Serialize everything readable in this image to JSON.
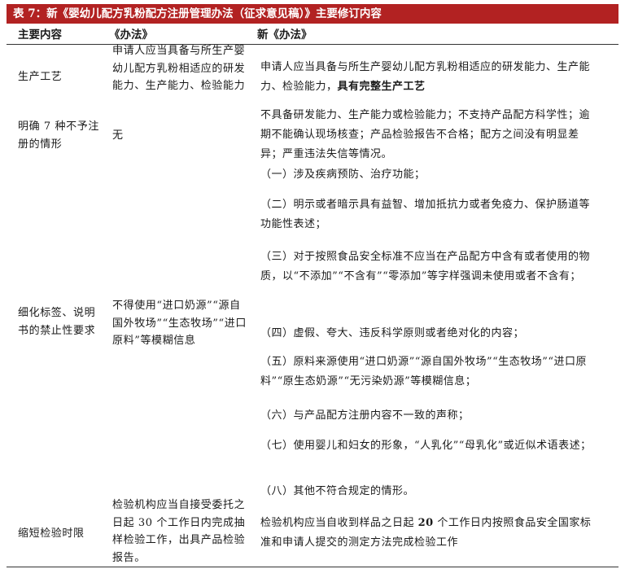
{
  "table": {
    "title": "表 7：新《婴幼儿配方乳粉配方注册管理办法（征求意见稿）》主要修订内容",
    "headers": [
      "主要内容",
      "《办法》",
      "新《办法》"
    ],
    "rows": [
      {
        "topic": "生产工艺",
        "old": "申请人应当具备与所生产婴幼儿配方乳粉相适应的研发能力、生产能力、检验能力",
        "new_plain": "申请人应当具备与所生产婴幼儿配方乳粉相适应的研发能力、生产能力、检验能力，",
        "new_bold": "具有完整生产工艺"
      },
      {
        "topic": "明确 7 种不予注册的情形",
        "old": "无",
        "new": "不具备研发能力、生产能力或检验能力；不支持产品配方科学性；逾期不能确认现场核查；产品检验报告不合格；配方之间没有明显差异；严重违法失信等情况。"
      },
      {
        "topic": "细化标签、说明书的禁止性要求",
        "old": "不得使用“进口奶源”“源自国外牧场”“生态牧场”“进口原料”等模糊信息",
        "items": [
          "（一）涉及疾病预防、治疗功能；",
          "（二）明示或者暗示具有益智、增加抵抗力或者免疫力、保护肠道等功能性表述；",
          "（三）对于按照食品安全标准不应当在产品配方中含有或者使用的物质，以“不添加”“不含有”“零添加”等字样强调未使用或者不含有；",
          "（四）虚假、夸大、违反科学原则或者绝对化的内容；",
          "（五）原料来源使用“进口奶源”“源自国外牧场”“生态牧场”“进口原料”“原生态奶源”“无污染奶源”等模糊信息；",
          "（六）与产品配方注册内容不一致的声称；",
          "（七）使用婴儿和妇女的形象，“人乳化”“母乳化”或近似术语表述；",
          "（八）其他不符合规定的情形。"
        ]
      },
      {
        "topic": "缩短检验时限",
        "old": "检验机构应当自接受委托之日起 30 个工作日内完成抽样检验工作，出具产品检验报告。",
        "new_plain": "检验机构应当自收到样品之日起 ",
        "new_bold": "20",
        "new_rest": " 个工作日内按照食品安全国家标准和申请人提交的测定方法完成检验工作"
      }
    ]
  }
}
